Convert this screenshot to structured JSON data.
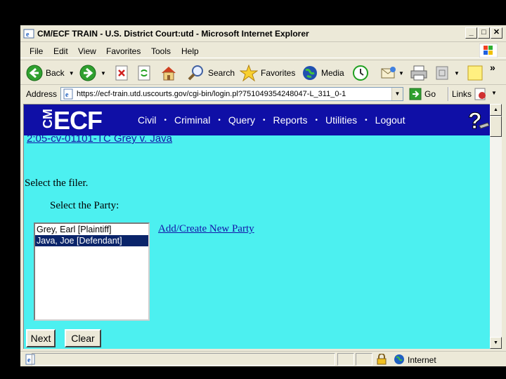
{
  "window": {
    "title": "CM/ECF TRAIN - U.S. District Court:utd - Microsoft Internet Explorer",
    "min_glyph": "_",
    "max_glyph": "□",
    "close_glyph": "✕"
  },
  "menu": {
    "items": [
      "File",
      "Edit",
      "View",
      "Favorites",
      "Tools",
      "Help"
    ]
  },
  "toolbar": {
    "back_label": "Back",
    "search_label": "Search",
    "favorites_label": "Favorites",
    "media_label": "Media",
    "chevron": "»"
  },
  "address": {
    "label": "Address",
    "url": "https://ecf-train.utd.uscourts.gov/cgi-bin/login.pl?751049354248047-L_311_0-1",
    "go_label": "Go",
    "links_label": "Links"
  },
  "ecf": {
    "cm_logo": "CM",
    "ecf_logo": "ECF",
    "nav": [
      "Civil",
      "Criminal",
      "Query",
      "Reports",
      "Utilities",
      "Logout"
    ],
    "nav_separator": "•"
  },
  "page": {
    "case_link": "2:05-cv-01101-TC Grey v. Java",
    "select_filer": "Select the filer.",
    "select_party": "Select the Party:",
    "parties": [
      {
        "label": "Grey, Earl [Plaintiff]",
        "selected": false
      },
      {
        "label": "Java, Joe [Defendant]",
        "selected": true
      }
    ],
    "add_party_link": "Add/Create New Party",
    "next_label": "Next",
    "clear_label": "Clear"
  },
  "status": {
    "zone_label": "Internet"
  },
  "colors": {
    "page_bg": "#4cf0f0",
    "header_bg": "#0f0fa6",
    "link": "#1414a8",
    "selection": "#0a246a"
  }
}
